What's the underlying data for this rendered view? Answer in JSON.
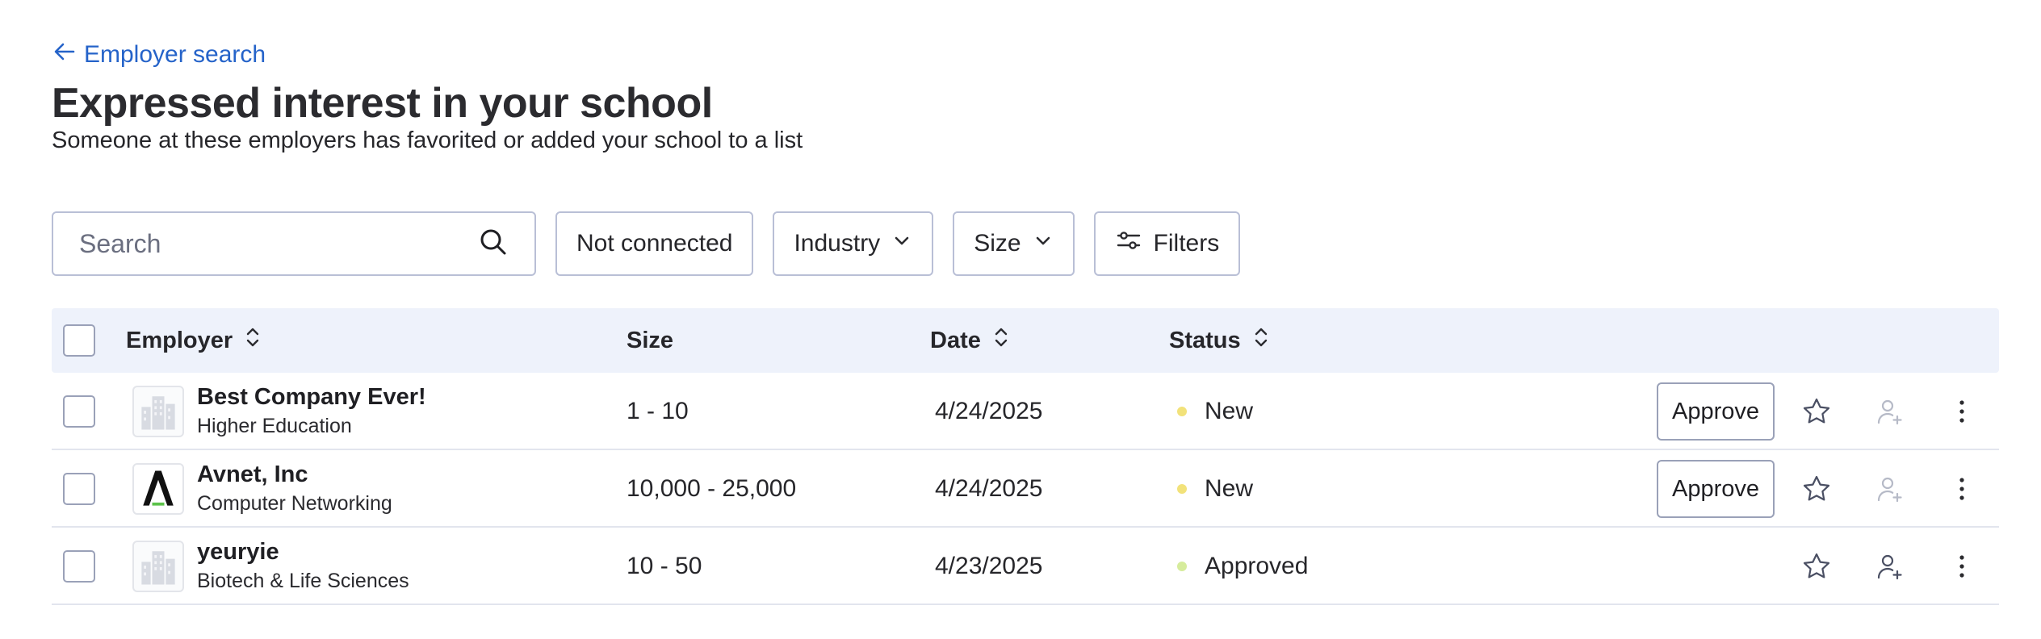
{
  "back_link": {
    "label": "Employer search"
  },
  "header": {
    "title": "Expressed interest in your school",
    "subtitle": "Someone at these employers has favorited or added your school to a list"
  },
  "toolbar": {
    "search_placeholder": "Search",
    "not_connected_label": "Not connected",
    "industry_label": "Industry",
    "size_label": "Size",
    "filters_label": "Filters"
  },
  "table": {
    "columns": {
      "employer": "Employer",
      "size": "Size",
      "date": "Date",
      "status": "Status"
    },
    "rows": [
      {
        "name": "Best Company Ever!",
        "industry": "Higher Education",
        "size": "1 - 10",
        "date": "4/24/2025",
        "status": "New",
        "status_color": "#f2e27a",
        "logo": "building-placeholder-logo",
        "approve_label": "Approve",
        "person_icon_color": "#b6bac7"
      },
      {
        "name": "Avnet, Inc",
        "industry": "Computer Networking",
        "size": "10,000 - 25,000",
        "date": "4/24/2025",
        "status": "New",
        "status_color": "#f2e27a",
        "logo": "avnet-logo",
        "approve_label": "Approve",
        "person_icon_color": "#b6bac7"
      },
      {
        "name": "yeuryie",
        "industry": "Biotech & Life Sciences",
        "size": "10 - 50",
        "date": "4/23/2025",
        "status": "Approved",
        "status_color": "#d6ec9c",
        "logo": "building-placeholder-logo",
        "person_icon_color": "#4a4f63"
      }
    ]
  },
  "colors": {
    "link": "#2563c9",
    "header_bg": "#eef2fb",
    "border": "#b9bfd6"
  }
}
